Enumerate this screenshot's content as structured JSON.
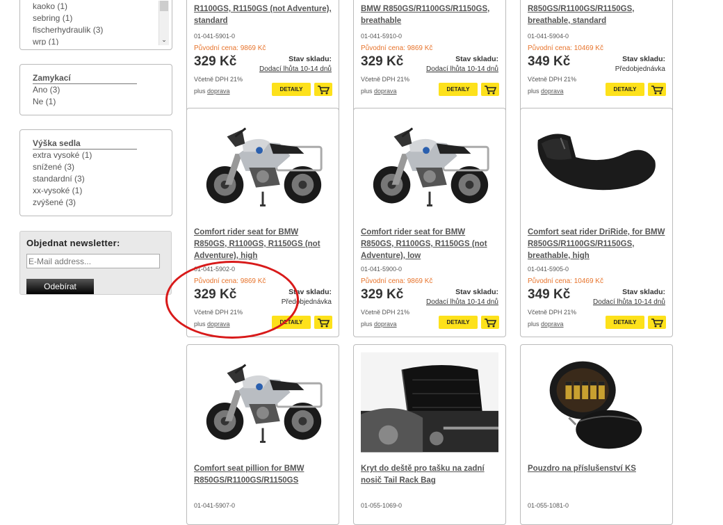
{
  "filters": {
    "brand_list": [
      "kaoko (1)",
      "sebring (1)",
      "fischerhydraulik (3)",
      "wrp (1)"
    ],
    "zamykaci": {
      "title": "Zamykací",
      "options": [
        "Ano (3)",
        "Ne (1)"
      ]
    },
    "vyska_sedla": {
      "title": "Výška sedla",
      "options": [
        "extra vysoké (1)",
        "snížené (3)",
        "standardní (3)",
        "xx-vysoké (1)",
        "zvýšené (3)"
      ]
    }
  },
  "newsletter": {
    "title": "Objednat newsletter:",
    "placeholder": "E-Mail address...",
    "button": "Odebírat"
  },
  "common": {
    "stock_label": "Stav skladu:",
    "vat": "Včetně DPH 21%",
    "shipping_prefix": "plus ",
    "shipping_link": "doprava",
    "details": "DETAILY"
  },
  "products": [
    {
      "title": "R1100GS, R1150GS (not Adventure), standard",
      "code": "01-041-5901-0",
      "orig": "Původní cena: 9869 Kč",
      "price": "329 Kč",
      "stock": "Dodací lhůta 10-14 dnů",
      "image": "motorcycle"
    },
    {
      "title": "BMW R850GS/R1100GS/R1150GS, breathable",
      "code": "01-041-5910-0",
      "orig": "Původní cena: 9869 Kč",
      "price": "329 Kč",
      "stock": "Dodací lhůta 10-14 dnů",
      "image": "motorcycle"
    },
    {
      "title": "R850GS/R1100GS/R1150GS, breathable, standard",
      "code": "01-041-5904-0",
      "orig": "Původní cena: 10469 Kč",
      "price": "349 Kč",
      "stock": "Předobjednávka",
      "image": "seat"
    },
    {
      "title": "Comfort rider seat for BMW R850GS, R1100GS, R1150GS (not Adventure), high",
      "code": "01-041-5902-0",
      "orig": "Původní cena: 9869 Kč",
      "price": "329 Kč",
      "stock": "Předobjednávka",
      "image": "motorcycle"
    },
    {
      "title": "Comfort rider seat for BMW R850GS, R1100GS, R1150GS (not Adventure), low",
      "code": "01-041-5900-0",
      "orig": "Původní cena: 9869 Kč",
      "price": "329 Kč",
      "stock": "Dodací lhůta 10-14 dnů",
      "image": "motorcycle"
    },
    {
      "title": "Comfort seat rider DriRide, for BMW R850GS/R1100GS/R1150GS, breathable, high",
      "code": "01-041-5905-0",
      "orig": "Původní cena: 10469 Kč",
      "price": "349 Kč",
      "stock": "Dodací lhůta 10-14 dnů",
      "image": "seat"
    },
    {
      "title": "Comfort seat pillion for BMW R850GS/R1100GS/R1150GS",
      "code": "01-041-5907-0",
      "image": "motorcycle"
    },
    {
      "title": "Kryt do deště pro tašku na zadní nosič Tail Rack Bag",
      "code": "01-055-1069-0",
      "image": "bag"
    },
    {
      "title": "Pouzdro na příslušenství KS",
      "code": "01-055-1081-0",
      "image": "pouch"
    }
  ]
}
